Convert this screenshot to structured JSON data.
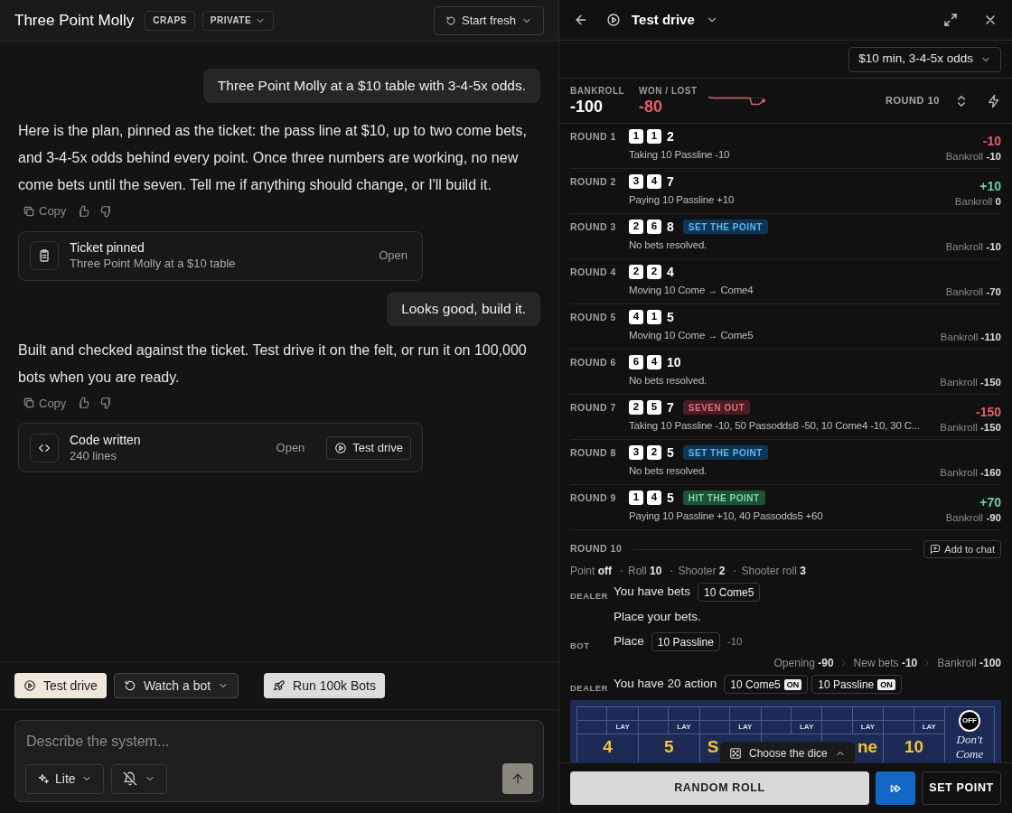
{
  "chat": {
    "title": "Three Point Molly",
    "badges": [
      {
        "text": "CRAPS",
        "dropdown": false
      },
      {
        "text": "PRIVATE",
        "dropdown": true
      }
    ],
    "start_button": "Start fresh",
    "messages": [
      {
        "kind": "user",
        "text": "Three Point Molly at a $10 table with 3-4-5x odds."
      },
      {
        "kind": "assistant",
        "text": "Here is the plan, pinned as the ticket: the pass line at $10, up to two come bets, and 3-4-5x odds behind every point. Once three numbers are working, no new come bets until the seven. Tell me if anything should change, or I'll build it.",
        "copy": "Copy",
        "card": {
          "kind": "ticket",
          "title": "Ticket pinned",
          "subtitle": "Three Point Molly at a $10 table",
          "open": "Open"
        }
      },
      {
        "kind": "user",
        "text": "Looks good, build it."
      },
      {
        "kind": "assistant",
        "text": "Built and checked against the ticket. Test drive it on the felt, or run it on 100,000 bots when you are ready.",
        "copy": "Copy",
        "card": {
          "kind": "code",
          "title": "Code written",
          "subtitle": "240 lines",
          "open": "Open",
          "button": "Test drive"
        }
      }
    ],
    "actions": [
      {
        "label": "Test drive",
        "kind": "primary"
      },
      {
        "label": "Watch a bot",
        "kind": "dropdown"
      },
      {
        "label": "Run 100k Bots",
        "kind": "light"
      }
    ],
    "composer": {
      "placeholder": "Describe the system...",
      "mode": "Lite"
    }
  },
  "drive": {
    "title": "Test drive",
    "table_select": "$10 min, 3-4-5x odds",
    "bankroll_label": "BANKROLL",
    "bankroll": "-100",
    "won_label": "WON / LOST",
    "won": "-80",
    "round_label": "ROUND 10",
    "rounds": [
      {
        "label": "ROUND 1",
        "dice": [
          "1",
          "1"
        ],
        "total": "2",
        "detail": "Taking 10 Passline -10",
        "result": "-10",
        "color": "#e0606e",
        "bankroll_label": "Bankroll",
        "bankroll": "-10"
      },
      {
        "label": "ROUND 2",
        "dice": [
          "3",
          "4"
        ],
        "total": "7",
        "detail": "Paying 10 Passline +10",
        "result": "+10",
        "color": "#6fcf97",
        "bankroll_label": "Bankroll",
        "bankroll": "0"
      },
      {
        "label": "ROUND 3",
        "dice": [
          "2",
          "6"
        ],
        "total": "8",
        "tag": {
          "text": "SET THE POINT",
          "kind": "point"
        },
        "detail": "No bets resolved.",
        "bankroll_label": "Bankroll",
        "bankroll": "-10"
      },
      {
        "label": "ROUND 4",
        "dice": [
          "2",
          "2"
        ],
        "total": "4",
        "detail": "Moving 10 Come → Come4",
        "bankroll_label": "Bankroll",
        "bankroll": "-70"
      },
      {
        "label": "ROUND 5",
        "dice": [
          "4",
          "1"
        ],
        "total": "5",
        "detail": "Moving 10 Come → Come5",
        "bankroll_label": "Bankroll",
        "bankroll": "-110"
      },
      {
        "label": "ROUND 6",
        "dice": [
          "6",
          "4"
        ],
        "total": "10",
        "detail": "No bets resolved.",
        "bankroll_label": "Bankroll",
        "bankroll": "-150"
      },
      {
        "label": "ROUND 7",
        "dice": [
          "2",
          "5"
        ],
        "total": "7",
        "tag": {
          "text": "SEVEN OUT",
          "kind": "seven_out"
        },
        "detail": "Taking 10 Passline -10, 50 Passodds8 -50, 10 Come4 -10, 30 C...",
        "result": "-150",
        "color": "#e0606e",
        "bankroll_label": "Bankroll",
        "bankroll": "-150"
      },
      {
        "label": "ROUND 8",
        "dice": [
          "3",
          "2"
        ],
        "total": "5",
        "tag": {
          "text": "SET THE POINT",
          "kind": "point"
        },
        "detail": "No bets resolved.",
        "bankroll_label": "Bankroll",
        "bankroll": "-160"
      },
      {
        "label": "ROUND 9",
        "dice": [
          "1",
          "4"
        ],
        "total": "5",
        "tag": {
          "text": "HIT THE POINT",
          "kind": "hit"
        },
        "detail": "Paying 10 Passline +10, 40 Passodds5 +60",
        "result": "+70",
        "color": "#6fcf97",
        "bankroll_label": "Bankroll",
        "bankroll": "-90"
      }
    ],
    "current": {
      "label": "ROUND 10",
      "add_button": "Add to chat",
      "stats": [
        {
          "label": "Point",
          "value": "off"
        },
        {
          "label": "Roll",
          "value": "10"
        },
        {
          "label": "Shooter",
          "value": "2"
        },
        {
          "label": "Shooter roll",
          "value": "3"
        }
      ],
      "log": [
        {
          "kind": "message",
          "speaker": "DEALER",
          "text": "You have bets",
          "chips": [
            {
              "text": "10 Come5"
            }
          ]
        },
        {
          "kind": "message",
          "text": "Place your bets."
        },
        {
          "kind": "message",
          "speaker": "BOT",
          "text": "Place",
          "chips": [
            {
              "text": "10 Passline"
            }
          ],
          "note": "-10"
        },
        {
          "kind": "summary",
          "items": [
            {
              "label": "Opening",
              "value": "-90"
            },
            {
              "label": "New bets",
              "value": "-10"
            },
            {
              "label": "Bankroll",
              "value": "-100"
            }
          ]
        },
        {
          "kind": "message",
          "speaker": "DEALER",
          "text": "You have 20 action",
          "chips": [
            {
              "text": "10 Come5",
              "badge": "ON"
            },
            {
              "text": "10 Passline",
              "badge": "ON"
            }
          ]
        }
      ],
      "table": {
        "boxes": [
          {
            "lay": "LAY",
            "number": "4"
          },
          {
            "lay": "LAY",
            "number": "5"
          },
          {
            "lay": "LAY",
            "number": "S"
          },
          {
            "lay": "LAY"
          },
          {
            "lay": "LAY",
            "number": "ne"
          },
          {
            "lay": "LAY",
            "number": "10"
          }
        ],
        "puck": "OFF",
        "dont_come": "Don't Come"
      },
      "dice_chooser": "Choose the dice"
    },
    "buttons": {
      "roll": "RANDOM ROLL",
      "set_point": "SET POINT"
    }
  }
}
